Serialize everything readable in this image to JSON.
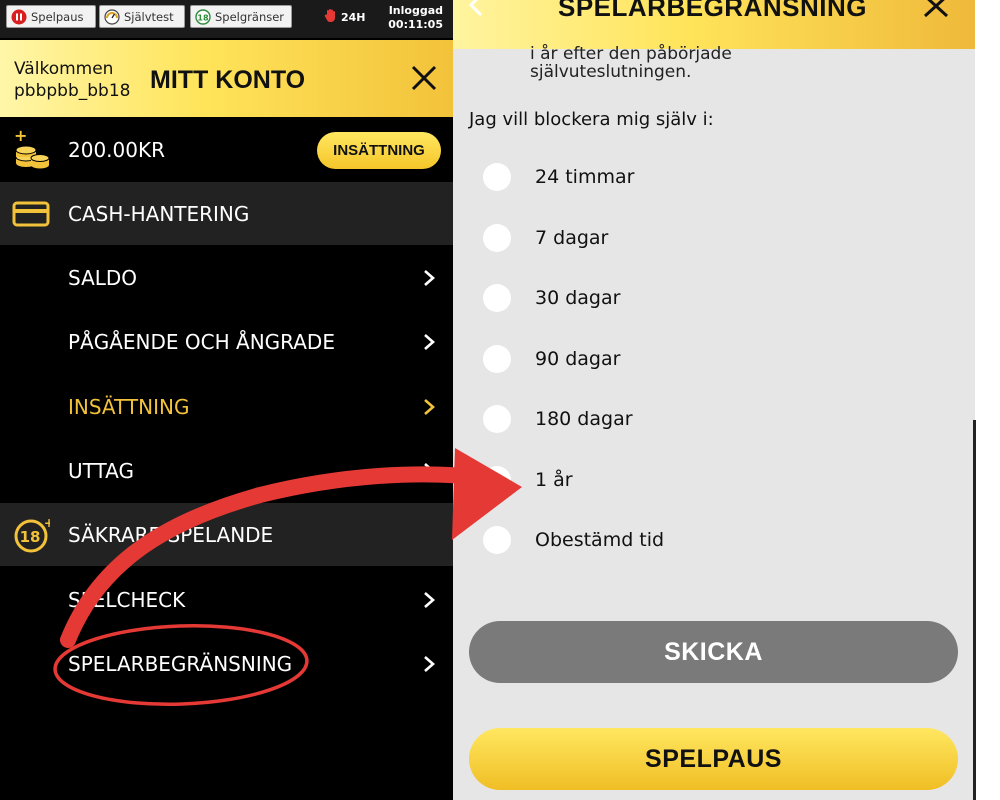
{
  "topbar": {
    "spelpaus_label": "Spelpaus",
    "sjalvtest_label": "Självtest",
    "spelgranser_label": "Spelgränser",
    "limit_24h": "24H",
    "login_label": "Inloggad",
    "login_time": "00:11:05"
  },
  "header": {
    "welcome": "Välkommen",
    "username": "pbbpbb_bb18",
    "title": "MITT KONTO"
  },
  "balance": {
    "amount": "200.00KR",
    "deposit_label": "INSÄTTNING"
  },
  "sections": {
    "cash": "CASH-HANTERING",
    "safer": "SÄKRARE SPELANDE"
  },
  "menu": {
    "saldo": "SALDO",
    "pending": "PÅGÅENDE OCH ÅNGRADE",
    "deposit": "INSÄTTNING",
    "withdraw": "UTTAG",
    "spelcheck": "SPELCHECK",
    "spelarbegransning": "SPELARBEGRÄNSNING"
  },
  "panel": {
    "title": "SPELARBEGRÄNSNING",
    "partial_line1": "i år efter den påbörjade",
    "partial_line2": "självuteslutningen.",
    "prompt": "Jag vill blockera mig själv i:",
    "options": [
      "24 timmar",
      "7 dagar",
      "30 dagar",
      "90 dagar",
      "180 dagar",
      "1 år",
      "Obestämd tid"
    ],
    "submit_label": "SKICKA",
    "pause_label": "SPELPAUS"
  },
  "colors": {
    "gold": "#f2c23a",
    "annotation_red": "#e53935",
    "submit_grey": "#7a7a7a"
  }
}
